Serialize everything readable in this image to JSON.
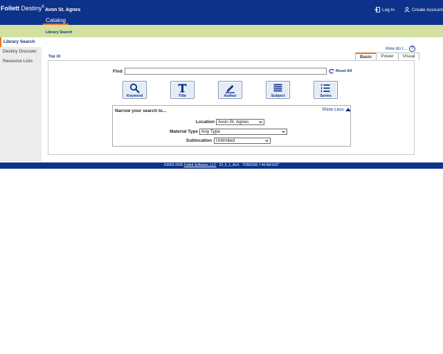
{
  "header": {
    "logo_bold": "Follett",
    "logo_regular": " Destiny",
    "logo_mark": "®",
    "site_name": "Avon St. Agnes",
    "catalog_tab": "Catalog",
    "login": "Log In",
    "create_account": "Create Account"
  },
  "subheader": {
    "breadcrumb": "Library Search"
  },
  "sidebar": {
    "items": [
      {
        "label": "Library Search",
        "active": true
      },
      {
        "label": "Destiny Discover",
        "active": false
      },
      {
        "label": "Resource Lists",
        "active": false
      }
    ]
  },
  "main": {
    "how_do_i": "How do I...",
    "help_symbol": "?",
    "top10": "Top 10",
    "tabs": [
      {
        "label": "Basic",
        "active": true
      },
      {
        "label": "Power",
        "active": false
      },
      {
        "label": "Visual",
        "active": false
      }
    ],
    "find_label": "Find",
    "find_value": "",
    "reset_all": "Reset All",
    "search_buttons": [
      {
        "label": "Keyword",
        "icon": "magnifier-icon"
      },
      {
        "label": "Title",
        "icon": "title-t-icon"
      },
      {
        "label": "Author",
        "icon": "pen-icon"
      },
      {
        "label": "Subject",
        "icon": "lines-icon"
      },
      {
        "label": "Series",
        "icon": "numbered-list-icon"
      }
    ],
    "narrow": {
      "title": "Narrow your search to...",
      "show_less": "Show Less",
      "location_label": "Location",
      "location_value": "Avon St. Agnes",
      "material_label": "Material Type",
      "material_value": "Any Type",
      "sublocation_label": "Sublocation",
      "sublocation_value": "Unlimited"
    }
  },
  "footer": {
    "copyright": "©2002-2025 ",
    "company": "Follett Software, LLC",
    "version": "22_5_1_AU1",
    "datetime": "7/29/2026 7:40 AM EDT"
  },
  "colors": {
    "header_bg": "#0d3289",
    "subheader_bg": "#d2e1a1",
    "accent": "#e8731c"
  }
}
